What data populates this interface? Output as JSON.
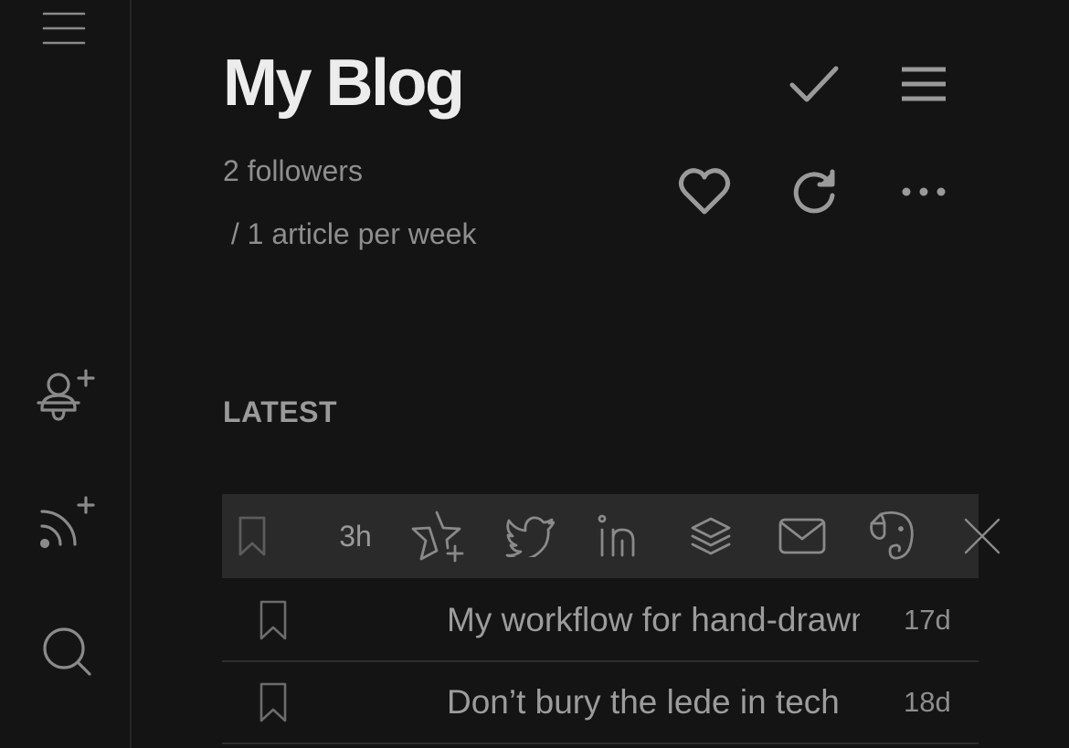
{
  "rail": {
    "icons": [
      "menu-icon",
      "add-user-icon",
      "add-feed-icon",
      "search-icon"
    ]
  },
  "blog": {
    "title": "My Blog",
    "followers": "2 followers",
    "frequency": " / 1 article per week"
  },
  "header_actions": [
    "check-icon",
    "list-icon",
    "heart-icon",
    "refresh-icon",
    "more-icon"
  ],
  "section": {
    "label": "LATEST"
  },
  "action_bar": {
    "time": "3h",
    "icons": [
      "bookmark-icon",
      "star-add-icon",
      "twitter-icon",
      "linkedin-icon",
      "buffer-icon",
      "mail-icon",
      "evernote-icon",
      "close-icon"
    ]
  },
  "articles": [
    {
      "title": "My workflow for hand-drawn",
      "age": "17d"
    },
    {
      "title": "Don’t bury the lede in tech",
      "age": "18d"
    }
  ]
}
